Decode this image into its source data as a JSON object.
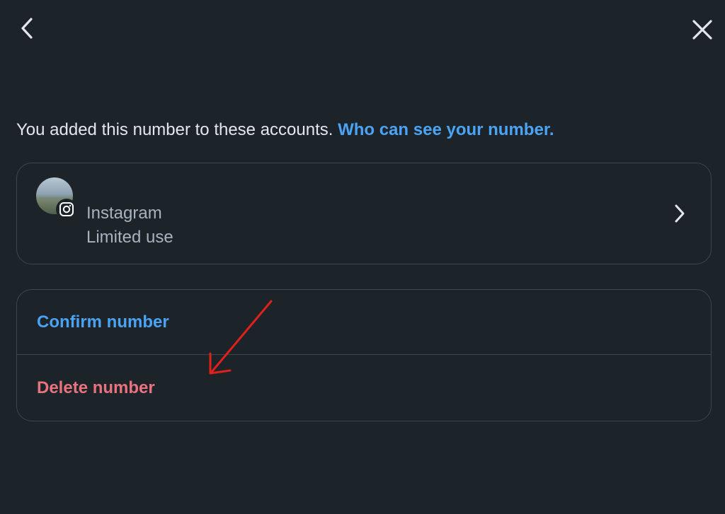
{
  "header": {
    "back_icon": "chevron-left-icon",
    "close_icon": "close-icon"
  },
  "intro": {
    "text": "You added this number to these accounts. ",
    "link": "Who can see your number."
  },
  "account": {
    "name": "Instagram",
    "status": "Limited use",
    "badge_icon": "instagram-icon",
    "chevron_icon": "chevron-right-icon"
  },
  "actions": {
    "confirm_label": "Confirm number",
    "delete_label": "Delete number"
  },
  "colors": {
    "background": "#1c2329",
    "link": "#4aa3f5",
    "danger": "#e8737e",
    "border": "#3b4652",
    "annotation": "#e0201a"
  }
}
